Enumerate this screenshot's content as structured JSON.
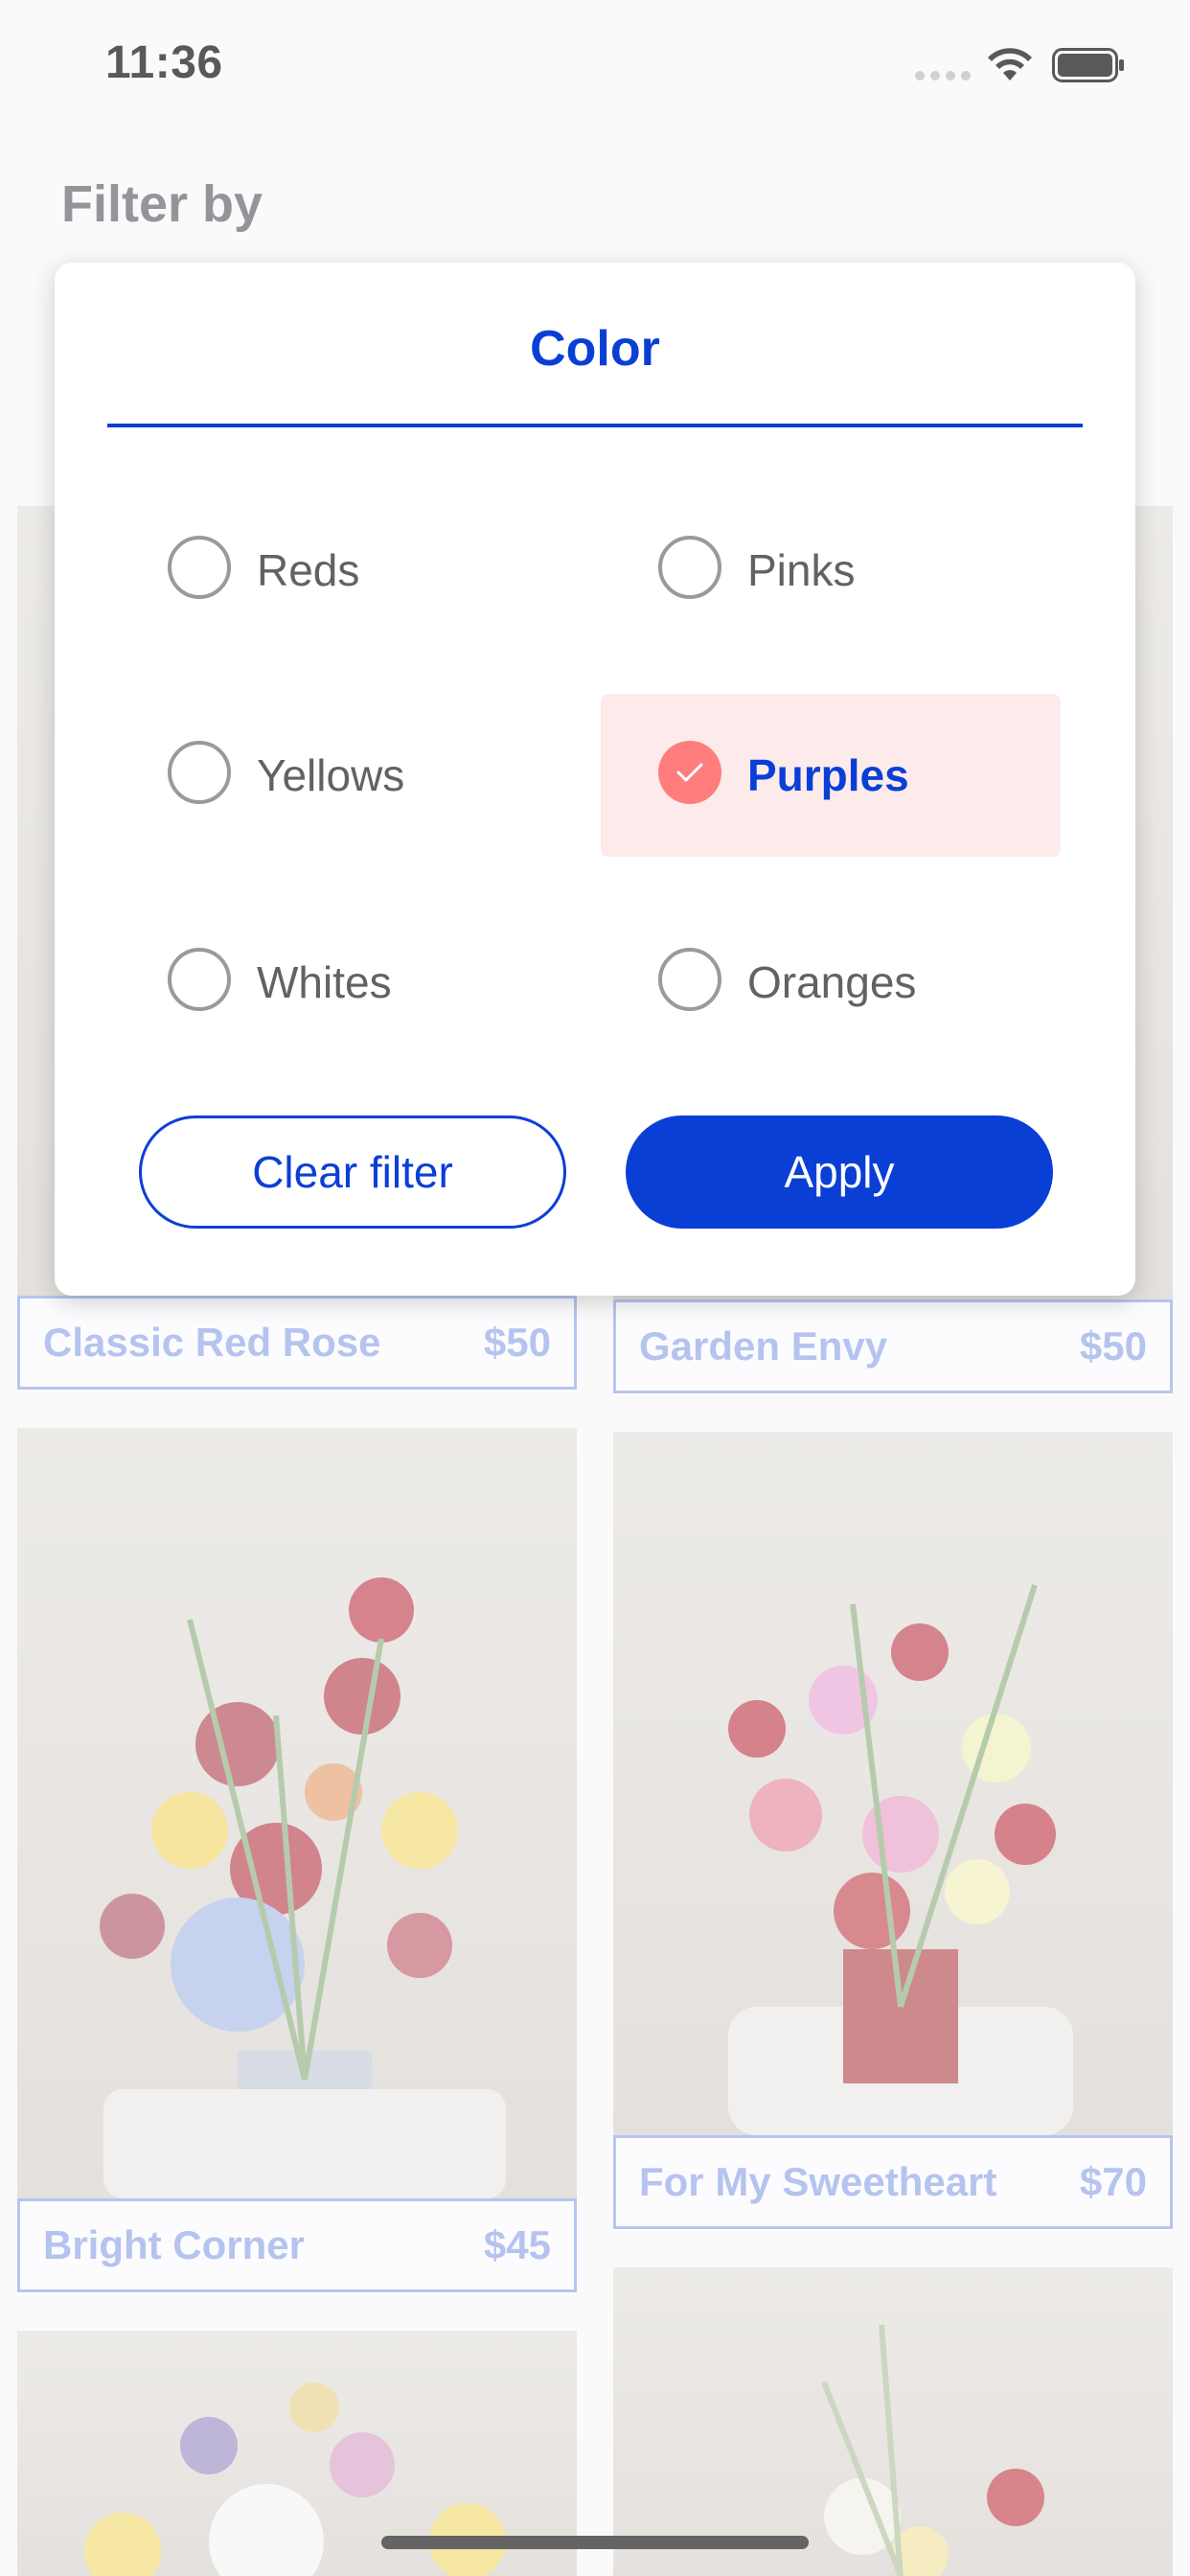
{
  "status_bar": {
    "time": "11:36"
  },
  "header": {
    "title": "Filter by"
  },
  "products": [
    {
      "name": "Classic Red Rose",
      "price": "$50"
    },
    {
      "name": "Garden Envy",
      "price": "$50"
    },
    {
      "name": "Bright Corner",
      "price": "$45"
    },
    {
      "name": "For My Sweetheart",
      "price": "$70"
    }
  ],
  "modal": {
    "tab_label": "Color",
    "options": [
      {
        "label": "Reds",
        "selected": false
      },
      {
        "label": "Pinks",
        "selected": false
      },
      {
        "label": "Yellows",
        "selected": false
      },
      {
        "label": "Purples",
        "selected": true
      },
      {
        "label": "Whites",
        "selected": false
      },
      {
        "label": "Oranges",
        "selected": false
      }
    ],
    "clear_label": "Clear filter",
    "apply_label": "Apply"
  },
  "colors": {
    "accent": "#0a3fd6",
    "selected_bg": "#fcebea",
    "check": "#ff7d7d"
  },
  "icons": [
    "signal-dots-icon",
    "wifi-icon",
    "battery-icon",
    "check-icon"
  ]
}
